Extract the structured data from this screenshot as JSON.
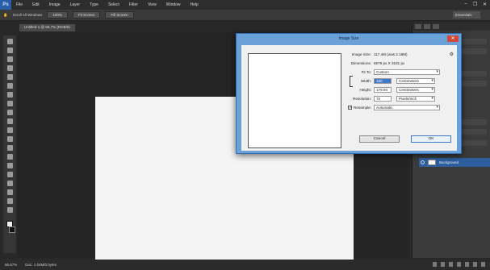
{
  "menubar": {
    "logo": "Ps",
    "items": [
      "File",
      "Edit",
      "Image",
      "Layer",
      "Type",
      "Select",
      "Filter",
      "View",
      "Window",
      "Help"
    ]
  },
  "optbar": {
    "scroll_all": "Scroll All Windows",
    "zoom_100": "100%",
    "fit_screen": "Fit Screen",
    "fill_screen": "Fill Screen",
    "workspace": "Essentials"
  },
  "doc_tab": "Untitled-1 @ 66.7% (RGB/8)",
  "dialog": {
    "title": "Image Size",
    "image_size_label": "Image Size:",
    "image_size_value": "117.4M (was 2.18M)",
    "dimensions_label": "Dimensions:",
    "dimensions_value": "6679 px  X  3181 px",
    "fit_to_label": "Fit To:",
    "fit_to_value": "Custom",
    "width_label": "Width:",
    "width_value": "100",
    "width_unit": "Centimeters",
    "height_label": "Height:",
    "height_value": "179.94",
    "height_unit": "Centimeters",
    "resolution_label": "Resolution:",
    "resolution_value": "72",
    "resolution_unit": "Pixels/Inch",
    "resample_label": "Resample:",
    "resample_value": "Automatic",
    "resample_checked": true,
    "cancel_label": "Cancel",
    "ok_label": "OK"
  },
  "layers": {
    "background_label": "Background"
  },
  "statusbar": {
    "zoom": "66.67%",
    "doc": "Doc: 1.04M/0 bytes"
  },
  "colors": {
    "accent": "#2d5f9e",
    "dialog_frame": "#6aa1d8",
    "canvas_bg": "#242424"
  }
}
